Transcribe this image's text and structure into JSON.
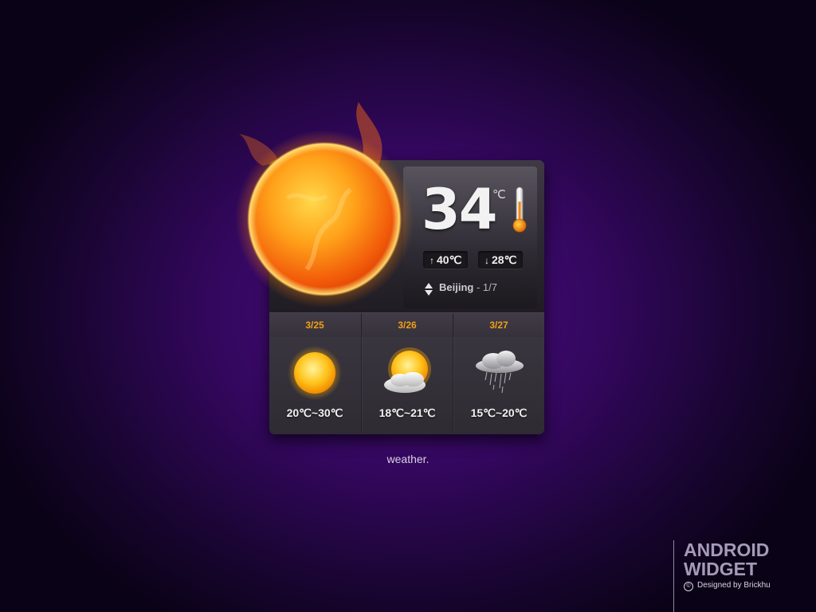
{
  "widget": {
    "current_temp": "34",
    "unit": "℃",
    "high": "40℃",
    "low": "28℃",
    "high_arrow": "↑",
    "low_arrow": "↓",
    "city": "Beijing",
    "separator": " - ",
    "page": "1/7",
    "current_icon": "sun-icon",
    "forecast": [
      {
        "date": "3/25",
        "range": "20℃~30℃",
        "icon": "sunny-icon"
      },
      {
        "date": "3/26",
        "range": "18℃~21℃",
        "icon": "partly-cloudy-icon"
      },
      {
        "date": "3/27",
        "range": "15℃~20℃",
        "icon": "rain-icon"
      }
    ]
  },
  "caption": "weather.",
  "brand": {
    "title_line1": "ANDROID",
    "title_line2": "WIDGET",
    "copyright_icon": "©",
    "credit": "Designed by Brickhu"
  },
  "colors": {
    "background": "#32075c",
    "date_accent": "#f0a018",
    "brand_text": "#a59ab8"
  }
}
